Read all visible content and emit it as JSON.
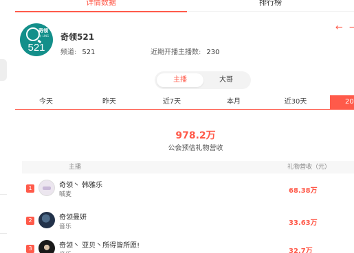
{
  "top_tabs": {
    "detail": "详情数据",
    "rank": "排行榜"
  },
  "header": {
    "logo": {
      "brand": "奇领",
      "sub": "QI LING",
      "number": "521"
    },
    "name": "奇领521",
    "room_label": "频道:",
    "room_value": "521",
    "anchor_count_label": "近期开播主播数:",
    "anchor_count_value": "230",
    "colors": {
      "accent": "#ff5a4a",
      "logo_bg": "#138f8a"
    }
  },
  "segment": {
    "host": "主播",
    "boss": "大哥"
  },
  "periods": [
    "今天",
    "昨天",
    "近7天",
    "本月",
    "近30天",
    "20"
  ],
  "summary": {
    "value": "978.2万",
    "label": "公会预估礼物营收"
  },
  "table": {
    "headers": {
      "name": "主播",
      "revenue": "礼物营收（元）"
    },
    "rows": [
      {
        "rank": "1",
        "name": "奇领丶 韩雅乐",
        "category": "喊麦",
        "value": "68.38万",
        "avatar": "avatar-logo"
      },
      {
        "rank": "2",
        "name": "奇领曼妍",
        "category": "音乐",
        "value": "33.63万",
        "avatar": "avatar-photo"
      },
      {
        "rank": "3",
        "name": "奇领丶 亚贝丶所得皆所愿!",
        "category": "音乐",
        "value": "32.7万",
        "avatar": "avatar-photo"
      }
    ]
  },
  "icons": [
    "arrow-left-icon",
    "arrow-right-icon"
  ]
}
